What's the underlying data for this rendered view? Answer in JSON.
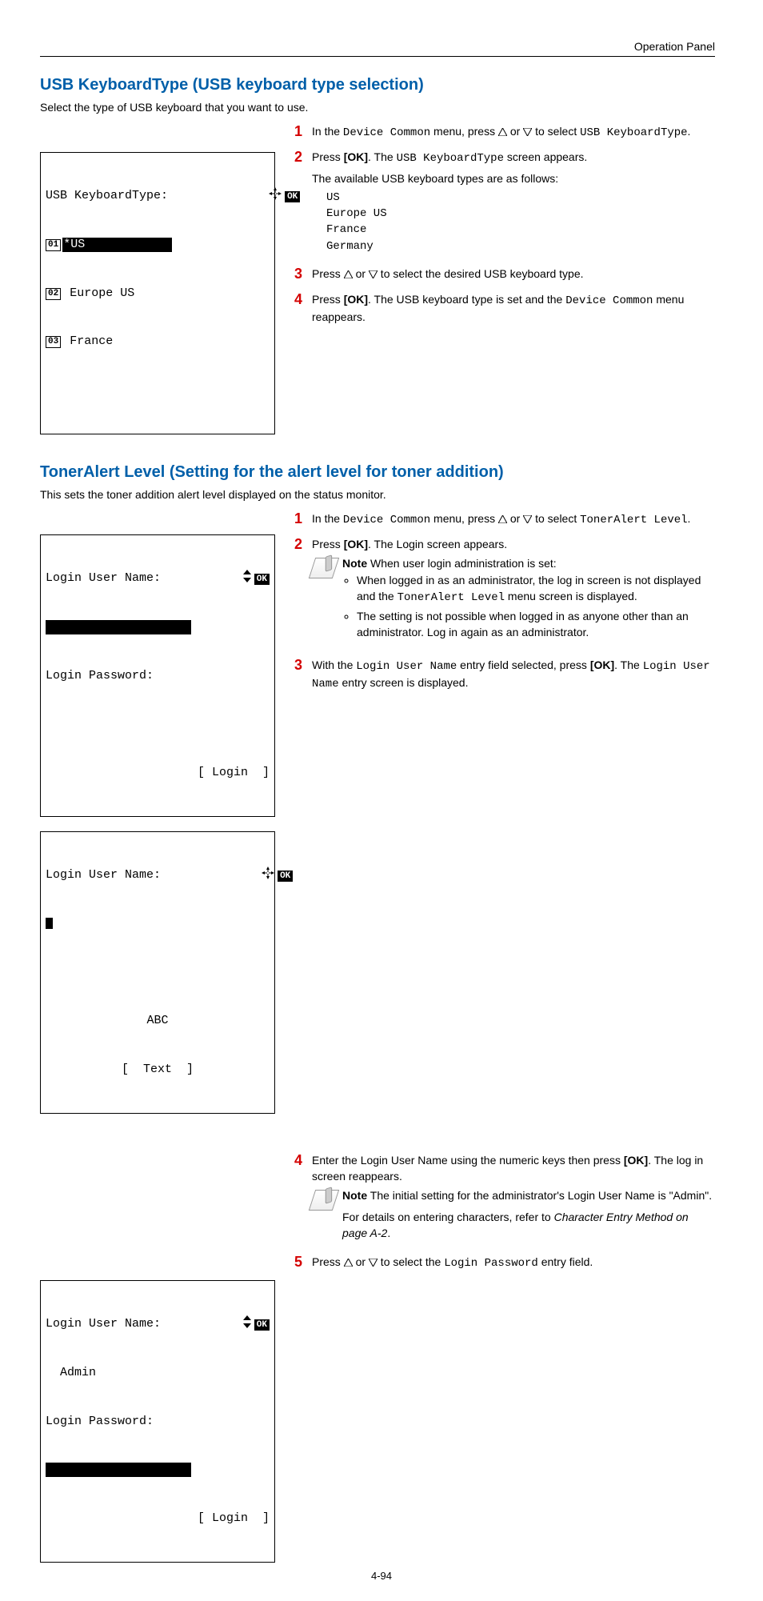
{
  "header": {
    "section_label": "Operation Panel"
  },
  "section1": {
    "title": "USB KeyboardType (USB keyboard type selection)",
    "intro": "Select the type of USB keyboard that you want to use.",
    "lcd": {
      "title": "USB KeyboardType:",
      "items_num": [
        "01",
        "02",
        "03"
      ],
      "items_text": [
        "*US",
        " Europe US",
        " France"
      ]
    },
    "steps": {
      "s1_a": "In the ",
      "s1_m1": "Device Common",
      "s1_b": " menu, press ",
      "s1_c": " to select ",
      "s1_m2": "USB KeyboardType",
      "s1_d": ".",
      "s2_a": "Press ",
      "s2_ok": "[OK]",
      "s2_b": ". The ",
      "s2_m": "USB KeyboardType",
      "s2_c": " screen appears.",
      "s2_sub": "The available USB keyboard types are as follows:",
      "s2_kb": [
        "US",
        "Europe US",
        "France",
        "Germany"
      ],
      "s3_a": "Press ",
      "s3_b": " to select the desired USB keyboard type.",
      "s4_a": "Press ",
      "s4_ok": "[OK]",
      "s4_b": ". The USB keyboard type is set and the ",
      "s4_m": "Device Common",
      "s4_c": " menu reappears."
    }
  },
  "section2": {
    "title": "TonerAlert Level (Setting for the alert level for toner addition)",
    "intro": "This sets the toner addition alert level displayed on the status monitor.",
    "lcd1": {
      "l1": "Login User Name:",
      "l2_blank_width": 19,
      "l3": "Login Password:",
      "l5": "[ Login  ]"
    },
    "lcd2": {
      "l1": "Login User Name:",
      "l4": "ABC",
      "l5": "[  Text  ]"
    },
    "lcd3": {
      "l1": "Login User Name:",
      "l2": "  Admin",
      "l3": "Login Password:",
      "l5": "[ Login  ]"
    },
    "steps": {
      "s1_a": "In the ",
      "s1_m1": "Device Common",
      "s1_b": " menu, press ",
      "s1_c": " to select ",
      "s1_m2": "TonerAlert Level",
      "s1_d": ".",
      "s2_a": "Press ",
      "s2_ok": "[OK]",
      "s2_b": ". The Login screen appears.",
      "note1_label": "Note",
      "note1_intro": "  When user login administration is set:",
      "note1_li1a": "When logged in as an administrator, the log in screen is not displayed and the ",
      "note1_li1m": "TonerAlert Level",
      "note1_li1b": " menu screen is displayed.",
      "note1_li2": "The setting is not possible when logged in as anyone other than an administrator. Log in again as an administrator.",
      "s3_a": "With the ",
      "s3_m1": "Login User Name",
      "s3_b": " entry field selected, press ",
      "s3_ok": "[OK]",
      "s3_c": ". The ",
      "s3_m2": "Login User Name",
      "s3_d": " entry screen is displayed.",
      "s4_a": "Enter the Login User Name using the numeric keys then press ",
      "s4_ok": "[OK]",
      "s4_b": ". The log in screen reappears.",
      "note2_label": "Note",
      "note2_body": "  The initial setting for the administrator's Login User Name is \"Admin\".",
      "note2_p2a": "For details on entering characters, refer to ",
      "note2_p2i": "Character Entry Method on page A-2",
      "note2_p2b": ".",
      "s5_a": "Press ",
      "s5_b": " to select the ",
      "s5_m": "Login Password",
      "s5_c": " entry field."
    }
  },
  "or_label": " or ",
  "upkey_label": "△",
  "downkey_label": "▽",
  "ok_label": "OK",
  "page_number": "4-94"
}
